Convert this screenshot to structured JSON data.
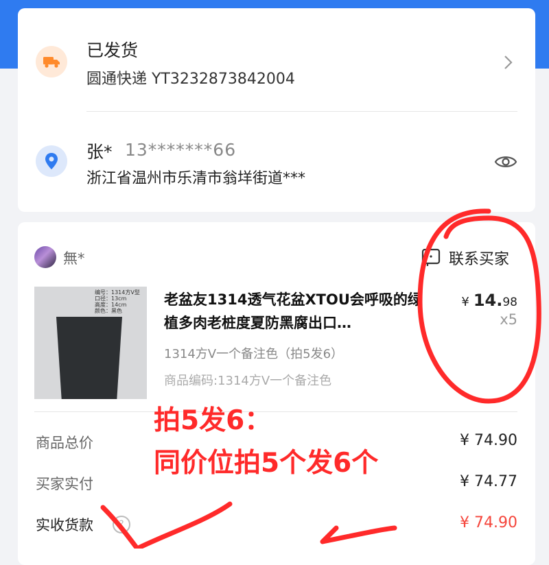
{
  "shipping": {
    "status": "已发货",
    "tracking": "圆通快递 YT3232873842004"
  },
  "address": {
    "name": "张*",
    "phone": "13*******66",
    "detail": "浙江省温州市乐清市翁垟街道***"
  },
  "order": {
    "buyer_name": "無*",
    "contact_label": "联系买家",
    "product": {
      "title": "老盆友1314透气花盆XTOU会呼吸的绿植多肉老桩度夏防黑腐出口…",
      "sku": "1314方V一个备注色（拍5发6）",
      "code": "商品编码:1314方V一个备注色",
      "price_currency": "¥",
      "price_int": "14.",
      "price_dec": "98",
      "quantity": "x5",
      "image_text": [
        "编号：1314方V型",
        "口径：13cm",
        "高度：14cm",
        "颜色：黑色"
      ]
    },
    "summary": {
      "total_label": "商品总价",
      "total_value": "¥ 74.90",
      "paid_label": "买家实付",
      "paid_value": "¥ 74.77",
      "received_label": "实收货款",
      "received_value": "¥ 74.90",
      "help_glyph": "?"
    }
  },
  "annotation": {
    "line1": "拍5发6：",
    "line2": "同价位拍5个发6个"
  },
  "colors": {
    "brand_blue": "#2f7bf0",
    "accent_red": "#f5453b",
    "annotation_red": "#ff2a2a",
    "ship_icon": "#ff8a2b",
    "location_icon": "#2f7bf0"
  }
}
